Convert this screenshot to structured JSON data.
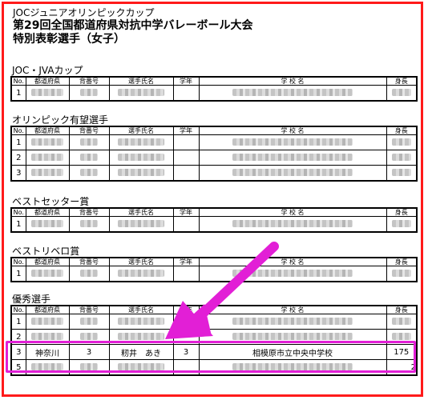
{
  "header": {
    "line1": "JOCジュニアオリンピックカップ",
    "line2": "第29回全国都道府県対抗中学バレーボール大会",
    "line3": "特別表彰選手（女子）"
  },
  "columns": [
    "No.",
    "都道府県",
    "背番号",
    "選手氏名",
    "学年",
    "学 校 名",
    "身長"
  ],
  "sections": [
    {
      "title": "JOC・JVAカップ",
      "rows": [
        "1"
      ]
    },
    {
      "title": "オリンピック有望選手",
      "rows": [
        "1",
        "2",
        "3"
      ]
    },
    {
      "title": "ベストセッター賞",
      "rows": [
        "1"
      ]
    },
    {
      "title": "ベストリベロ賞",
      "rows": [
        "1"
      ]
    },
    {
      "title": "優秀選手",
      "rows": [
        "1",
        "2"
      ]
    }
  ],
  "highlight_row": {
    "no": "3",
    "prefecture": "神奈川",
    "number": "3",
    "name": "籾井　あき",
    "grade": "3",
    "school": "相模原市立中央中学校",
    "height": "175"
  },
  "partial_row": {
    "no": "5",
    "height": "2"
  },
  "colors": {
    "frame": "#ff1a1a",
    "highlight": "#e21fd6"
  }
}
